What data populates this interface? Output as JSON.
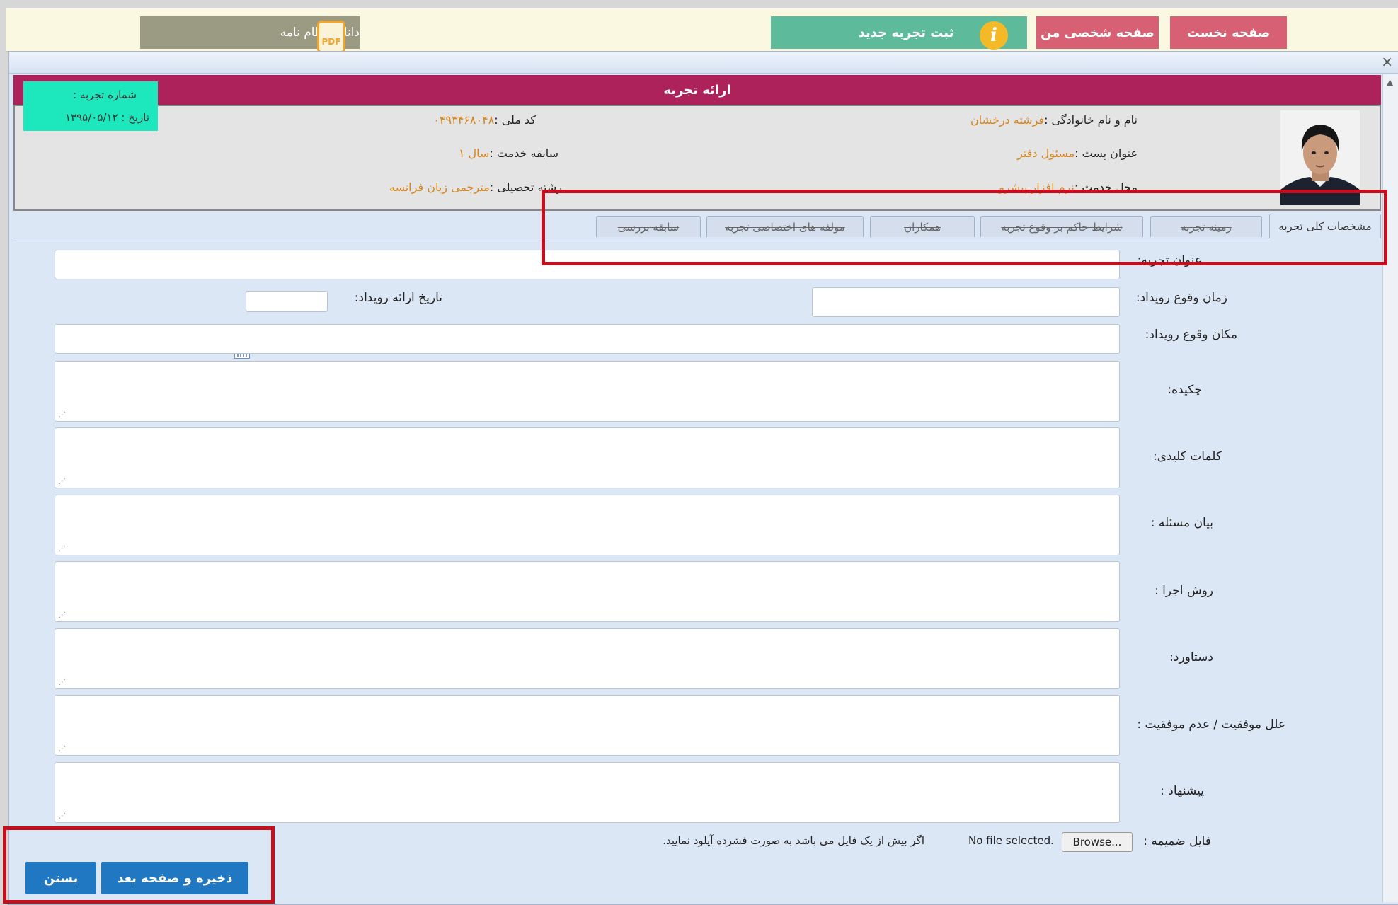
{
  "topbar": {
    "home_label": "صفحه نخست",
    "profile_label": "صفحه شخصی من",
    "new_experience_label": "ثبت تجربه جدید",
    "info_icon": "i",
    "download_label": "دانلود نظام نامه",
    "pdf_icon_text": "PDF"
  },
  "dialog": {
    "close_glyph": "×",
    "title": "ارائه تجربه",
    "experience_number_label": "شماره تجربه :",
    "experience_date_label": "تاریخ : ۱۳۹۵/۰۵/۱۲"
  },
  "person": {
    "name_label": "نام و نام خانوادگی :",
    "name_value": "فرشته درخشان",
    "national_id_label": "کد ملی :",
    "national_id_value": "۰۴۹۳۴۶۸۰۴۸",
    "position_label": "عنوان پست :",
    "position_value": "مسئول دفتر",
    "service_label": "سابقه خدمت :",
    "service_value": "سال ۱",
    "workplace_label": "محل خدمت :",
    "workplace_value": "نرم افزار پیشرو",
    "field_label": "رشته تحصیلی :",
    "field_value": "مترجمی زبان فرانسه"
  },
  "tabs": [
    {
      "label": "مشخصات کلی تجربه"
    },
    {
      "label": "زمینه تجربه"
    },
    {
      "label": "شرایط حاکم بر وقوع تجربه"
    },
    {
      "label": "همکاران"
    },
    {
      "label": "مولفه های اختصاصی تجربه"
    },
    {
      "label": "سابقه بررسی"
    }
  ],
  "form": {
    "title_label": "عنوان تجربه:",
    "event_time_label": "زمان وقوع رویداد:",
    "present_date_label": "تاریخ ارائه رویداد:",
    "event_place_label": "مکان وقوع رویداد:",
    "abstract_label": "چکیده:",
    "keywords_label": "کلمات کلیدی:",
    "problem_label": "بیان مسئله :",
    "method_label": "روش اجرا :",
    "achievement_label": "دستاورد:",
    "reasons_label": "علل موفقیت / عدم موفقیت :",
    "suggestion_label": "پیشنهاد :",
    "attachment_label": "فایل ضمیمه :",
    "browse_label": "Browse...",
    "no_file_label": "No file selected.",
    "attachment_hint": "اگر بیش از یک فایل می باشد به صورت فشرده آپلود نمایید."
  },
  "actions": {
    "save_next_label": "ذخیره و صفحه بعد",
    "close_label": "بستن"
  },
  "colors": {
    "header": "#ad225a",
    "pink_button": "#d86074",
    "green_button": "#5dbb9b",
    "blue_button": "#1f78c1",
    "highlight_red": "#c50f1e"
  }
}
